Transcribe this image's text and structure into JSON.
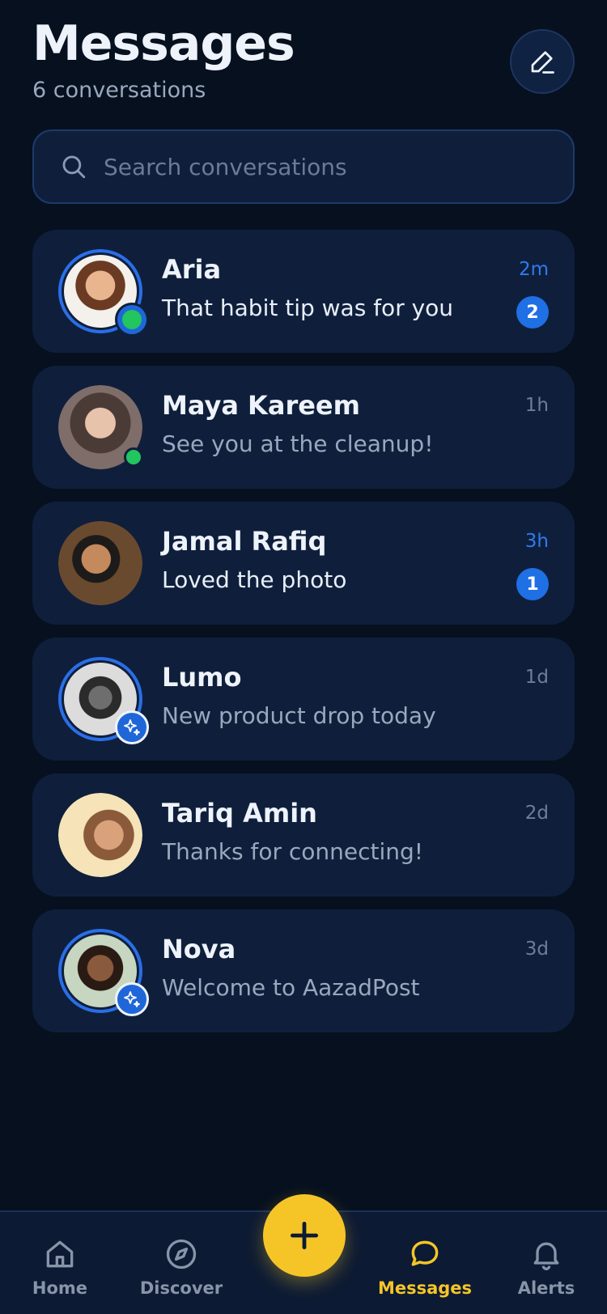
{
  "header": {
    "title": "Messages",
    "subtitle": "6 conversations"
  },
  "search": {
    "placeholder": "Search conversations"
  },
  "conversations": [
    {
      "name": "Aria",
      "preview": "That habit tip was for you",
      "time": "2m",
      "unread": 2
    },
    {
      "name": "Maya Kareem",
      "preview": "See you at the cleanup!",
      "time": "1h",
      "unread": 0
    },
    {
      "name": "Jamal Rafiq",
      "preview": "Loved the photo",
      "time": "3h",
      "unread": 1
    },
    {
      "name": "Lumo",
      "preview": "New product drop today",
      "time": "1d",
      "unread": 0
    },
    {
      "name": "Tariq Amin",
      "preview": "Thanks for connecting!",
      "time": "2d",
      "unread": 0
    },
    {
      "name": "Nova",
      "preview": "Welcome to AazadPost",
      "time": "3d",
      "unread": 0
    }
  ],
  "nav": {
    "home": "Home",
    "discover": "Discover",
    "messages": "Messages",
    "alerts": "Alerts"
  },
  "colors": {
    "background": "#06101f",
    "card": "#0f1f3b",
    "accent": "#1f6fe5",
    "fab": "#f5c528",
    "online": "#22c55e"
  }
}
